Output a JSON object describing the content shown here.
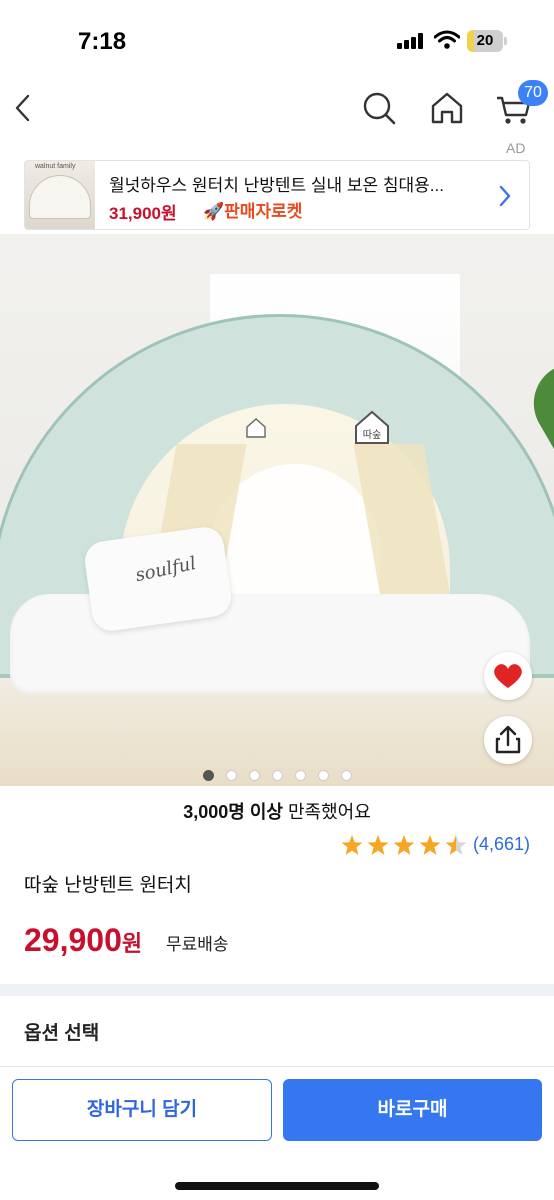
{
  "status_bar": {
    "time": "7:18",
    "battery": "20",
    "battery_level_percent": 20,
    "icons": [
      "signal-icon",
      "wifi-icon",
      "battery-icon"
    ]
  },
  "nav": {
    "icons": [
      "back-icon",
      "search-icon",
      "home-icon",
      "cart-icon"
    ],
    "cart_badge": "70"
  },
  "ad": {
    "label": "AD",
    "thumb_text": "walnut family",
    "title": "월넛하우스 원터치 난방텐트 실내 보온 침대용...",
    "price": "31,900원",
    "rocket_label": "🚀판매자로켓"
  },
  "gallery": {
    "image_text": "soulful",
    "logo_text": "따숲",
    "total_images": 7,
    "current_index": 1
  },
  "product": {
    "satisfaction_count": "3,000명 이상",
    "satisfaction_suffix": " 만족했어요",
    "rating": 4.5,
    "review_count": "(4,661)",
    "name": "따숲 난방텐트 원터치",
    "price": "29,900",
    "price_unit": "원",
    "shipping": "무료배송",
    "heart_color": "#e02323"
  },
  "options": {
    "title": "옵션 선택"
  },
  "bottom": {
    "cart_button": "장바구니 담기",
    "buy_button": "바로구매"
  },
  "colors": {
    "accent": "#3577f0",
    "price": "#c8102e",
    "star": "#f6a623",
    "review_link": "#2f6bd6"
  }
}
